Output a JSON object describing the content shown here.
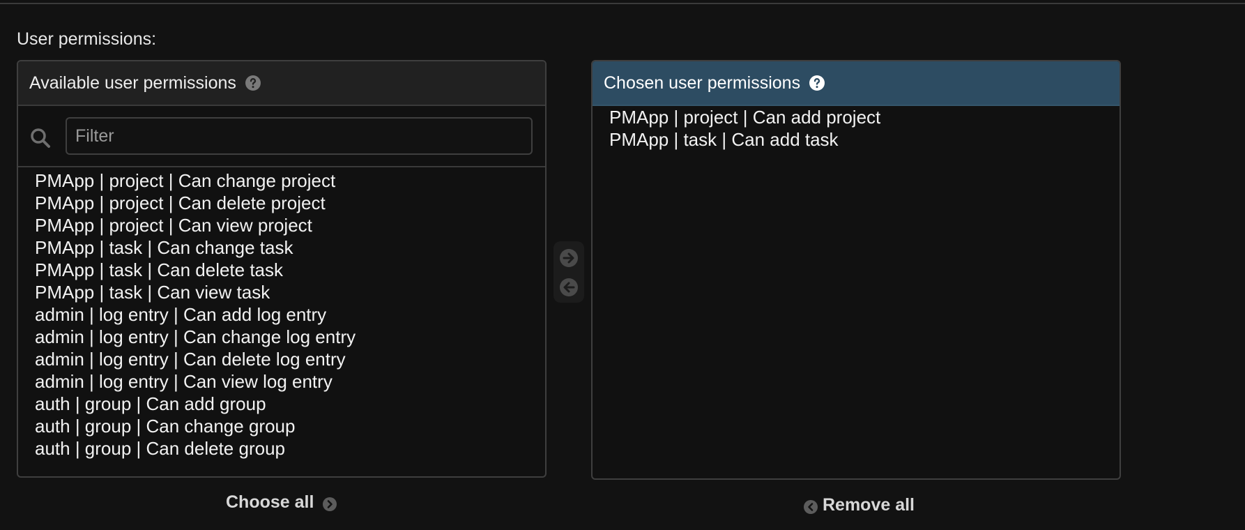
{
  "field": {
    "label": "User permissions:"
  },
  "available": {
    "title": "Available user permissions",
    "filter_placeholder": "Filter",
    "filter_value": "",
    "items": [
      "PMApp | project | Can change project",
      "PMApp | project | Can delete project",
      "PMApp | project | Can view project",
      "PMApp | task | Can change task",
      "PMApp | task | Can delete task",
      "PMApp | task | Can view task",
      "admin | log entry | Can add log entry",
      "admin | log entry | Can change log entry",
      "admin | log entry | Can delete log entry",
      "admin | log entry | Can view log entry",
      "auth | group | Can add group",
      "auth | group | Can change group",
      "auth | group | Can delete group"
    ],
    "choose_all_label": "Choose all"
  },
  "chosen": {
    "title": "Chosen user permissions",
    "items": [
      "PMApp | project | Can add project",
      "PMApp | task | Can add task"
    ],
    "remove_all_label": "Remove all"
  },
  "icons": {
    "help": "question-circle-icon",
    "search": "magnifier-icon",
    "add": "arrow-right-circle-icon",
    "remove": "arrow-left-circle-icon",
    "choose_all": "chevron-right-circle-icon",
    "remove_all": "chevron-left-circle-icon"
  },
  "colors": {
    "background": "#121212",
    "chosen_header": "#2d4c62",
    "available_header": "#212121"
  }
}
